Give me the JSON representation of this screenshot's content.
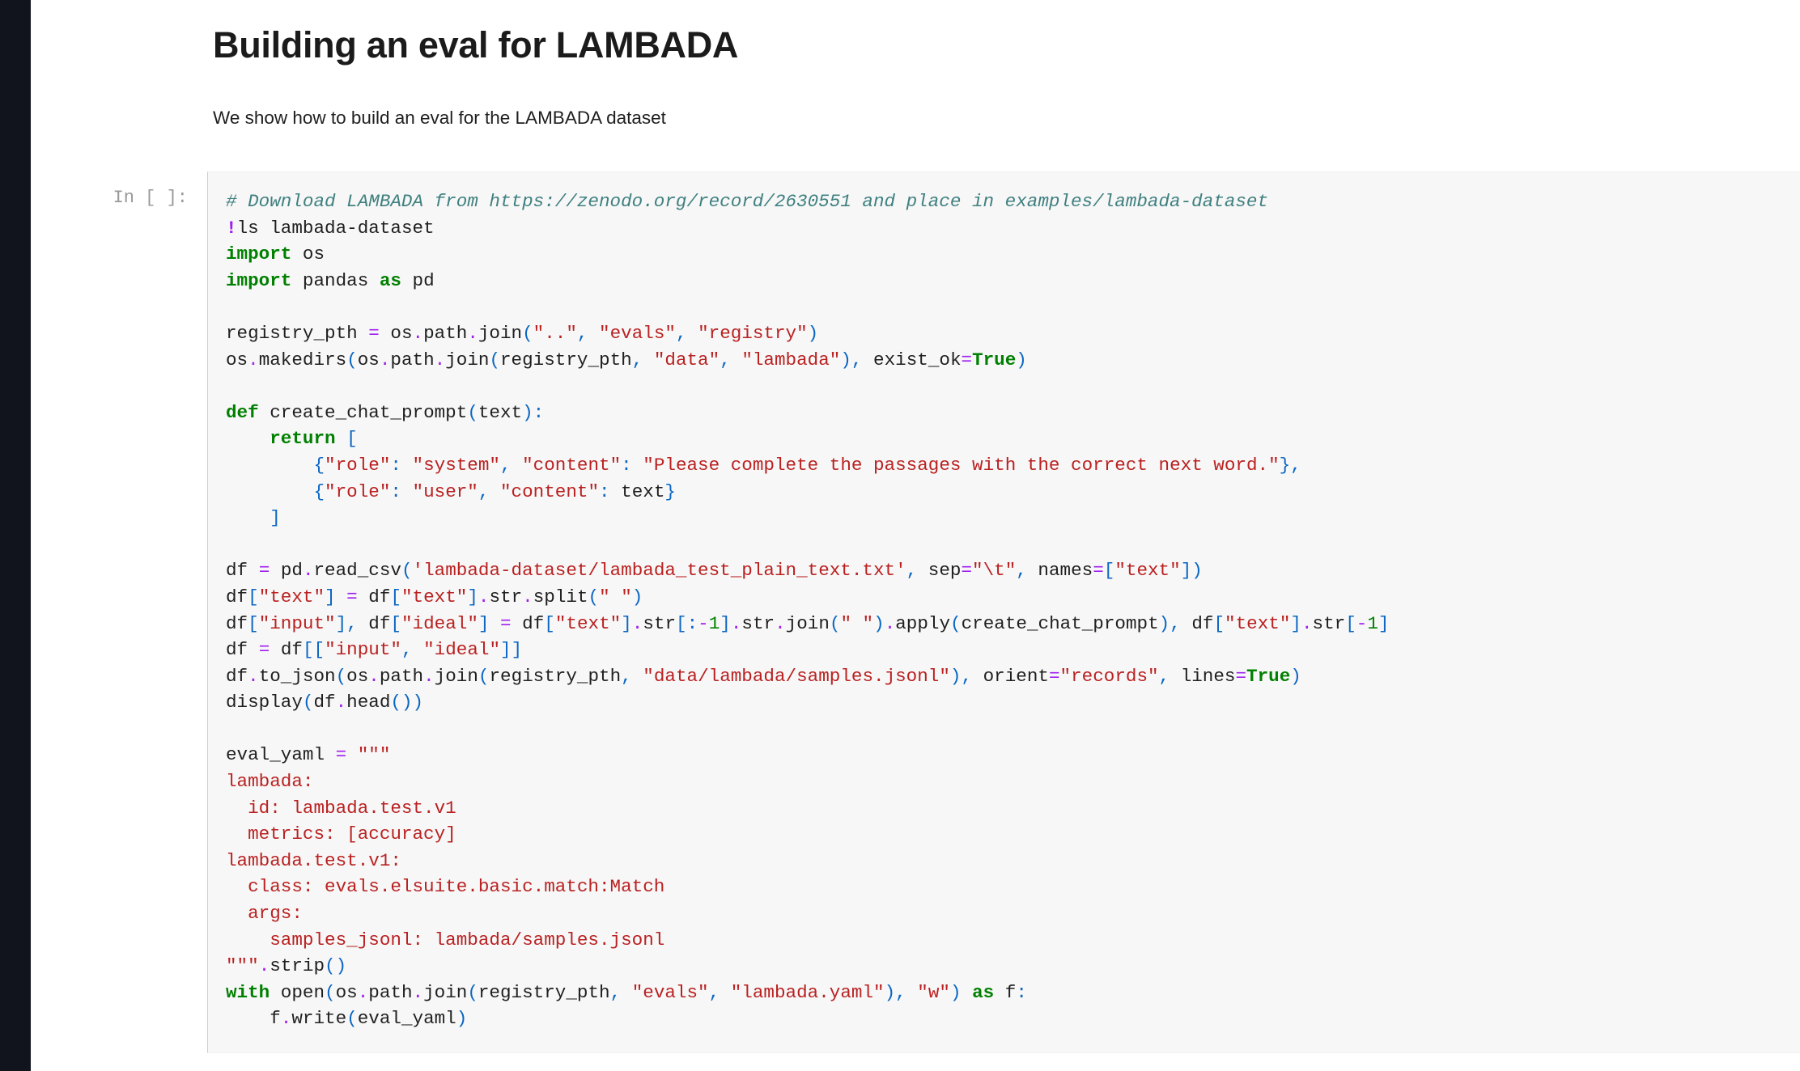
{
  "window": {
    "title": "Building an eval for LAMBADA",
    "rail_color": "#11141c",
    "cell_bg": "#f7f7f7"
  },
  "markdown": {
    "heading": "Building an eval for LAMBADA",
    "subtitle": "We show how to build an eval for the LAMBADA dataset"
  },
  "code_cell": {
    "prompt_label": "In [ ]:",
    "execution_count": "",
    "language": "python",
    "source_lines": [
      "# Download LAMBADA from https://zenodo.org/record/2630551 and place in examples/lambada-dataset",
      "!ls lambada-dataset",
      "import os",
      "import pandas as pd",
      "",
      "registry_pth = os.path.join(\"..\", \"evals\", \"registry\")",
      "os.makedirs(os.path.join(registry_pth, \"data\", \"lambada\"), exist_ok=True)",
      "",
      "def create_chat_prompt(text):",
      "    return [",
      "        {\"role\": \"system\", \"content\": \"Please complete the passages with the correct next word.\"},",
      "        {\"role\": \"user\", \"content\": text}",
      "    ]",
      "",
      "df = pd.read_csv('lambada-dataset/lambada_test_plain_text.txt', sep=\"\\t\", names=[\"text\"])",
      "df[\"text\"] = df[\"text\"].str.split(\" \")",
      "df[\"input\"], df[\"ideal\"] = df[\"text\"].str[:-1].str.join(\" \").apply(create_chat_prompt), df[\"text\"].str[-1]",
      "df = df[[\"input\", \"ideal\"]]",
      "df.to_json(os.path.join(registry_pth, \"data/lambada/samples.jsonl\"), orient=\"records\", lines=True)",
      "display(df.head())",
      "",
      "eval_yaml = \"\"\"",
      "lambada:",
      "  id: lambada.test.v1",
      "  metrics: [accuracy]",
      "lambada.test.v1:",
      "  class: evals.elsuite.basic.match:Match",
      "  args:",
      "    samples_jsonl: lambada/samples.jsonl",
      "\"\"\".strip()",
      "with open(os.path.join(registry_pth, \"evals\", \"lambada.yaml\"), \"w\") as f:",
      "    f.write(eval_yaml)"
    ]
  },
  "syntax_colors": {
    "comment": "#408080",
    "keyword": "#008000",
    "string": "#ba2121",
    "operator": "#a020f0",
    "bracket": "#0b66c3",
    "number": "#008000",
    "plain": "#1f1f1f",
    "prompt": "#999999"
  }
}
